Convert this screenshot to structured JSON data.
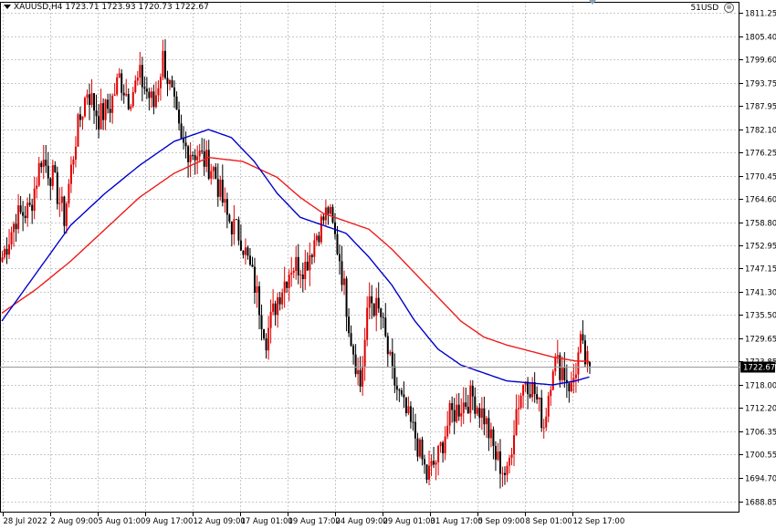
{
  "header": {
    "symbol_line": "XAUUSD,H4  1723.71 1723.93 1720.73 1722.67",
    "indicator_label": "51USD",
    "close_glyph": "⊗"
  },
  "colors": {
    "bull": "#e00000",
    "bear": "#000000",
    "ma_fast": "#0000cc",
    "ma_slow": "#ee1c1c",
    "grid": "#c8c8c8",
    "price_tag_bg": "#000000",
    "price_tag_text": "#ffffff"
  },
  "chart_data": {
    "type": "candlestick",
    "symbol": "XAUUSD",
    "timeframe": "H4",
    "ohlc_current": {
      "open": 1723.71,
      "high": 1723.93,
      "low": 1720.73,
      "close": 1722.67
    },
    "current_price_label": "1722.67",
    "ylim": [
      1686.0,
      1814.0
    ],
    "y_ticks": [
      "1811.25",
      "1805.40",
      "1799.60",
      "1793.75",
      "1787.95",
      "1782.10",
      "1776.25",
      "1770.45",
      "1764.60",
      "1758.80",
      "1752.95",
      "1747.15",
      "1741.30",
      "1735.50",
      "1729.65",
      "1723.85",
      "1718.00",
      "1712.20",
      "1706.35",
      "1700.55",
      "1694.70",
      "1688.85"
    ],
    "x_labels": [
      "28 Jul 2022",
      "2 Aug 09:00",
      "5 Aug 01:00",
      "9 Aug 17:00",
      "12 Aug 09:00",
      "17 Aug 01:00",
      "19 Aug 17:00",
      "24 Aug 09:00",
      "29 Aug 01:00",
      "31 Aug 17:00",
      "5 Sep 09:00",
      "8 Sep 01:00",
      "12 Sep 17:00"
    ],
    "waypoints": [
      [
        0,
        1750
      ],
      [
        6,
        1760
      ],
      [
        12,
        1762
      ],
      [
        17,
        1775
      ],
      [
        22,
        1770
      ],
      [
        27,
        1760
      ],
      [
        32,
        1780
      ],
      [
        37,
        1792
      ],
      [
        42,
        1785
      ],
      [
        47,
        1788
      ],
      [
        51,
        1795
      ],
      [
        55,
        1790
      ],
      [
        60,
        1795
      ],
      [
        66,
        1788
      ],
      [
        70,
        1800
      ],
      [
        74,
        1790
      ],
      [
        78,
        1778
      ],
      [
        85,
        1776
      ],
      [
        92,
        1772
      ],
      [
        98,
        1760
      ],
      [
        104,
        1755
      ],
      [
        110,
        1743
      ],
      [
        115,
        1730
      ],
      [
        120,
        1740
      ],
      [
        126,
        1748
      ],
      [
        132,
        1748
      ],
      [
        137,
        1756
      ],
      [
        142,
        1762
      ],
      [
        147,
        1750
      ],
      [
        152,
        1730
      ],
      [
        156,
        1718
      ],
      [
        160,
        1740
      ],
      [
        165,
        1735
      ],
      [
        170,
        1720
      ],
      [
        175,
        1712
      ],
      [
        180,
        1705
      ],
      [
        185,
        1695
      ],
      [
        190,
        1700
      ],
      [
        195,
        1710
      ],
      [
        200,
        1713
      ],
      [
        205,
        1715
      ],
      [
        210,
        1710
      ],
      [
        215,
        1700
      ],
      [
        220,
        1695
      ],
      [
        224,
        1712
      ],
      [
        228,
        1720
      ],
      [
        232,
        1716
      ],
      [
        236,
        1708
      ],
      [
        240,
        1724
      ],
      [
        244,
        1722
      ],
      [
        248,
        1717
      ],
      [
        252,
        1728
      ],
      [
        254,
        1724
      ],
      [
        256,
        1722.67
      ]
    ],
    "ma_fast": {
      "color": "blue",
      "points": [
        [
          0,
          1734
        ],
        [
          15,
          1746
        ],
        [
          30,
          1758
        ],
        [
          45,
          1766
        ],
        [
          60,
          1773
        ],
        [
          75,
          1779
        ],
        [
          90,
          1782
        ],
        [
          100,
          1780
        ],
        [
          110,
          1774
        ],
        [
          120,
          1766
        ],
        [
          130,
          1760
        ],
        [
          140,
          1758
        ],
        [
          150,
          1756
        ],
        [
          160,
          1750
        ],
        [
          170,
          1743
        ],
        [
          180,
          1734
        ],
        [
          190,
          1727
        ],
        [
          200,
          1723
        ],
        [
          210,
          1721
        ],
        [
          220,
          1719
        ],
        [
          230,
          1718.5
        ],
        [
          240,
          1718
        ],
        [
          250,
          1719
        ],
        [
          256,
          1720
        ]
      ]
    },
    "ma_slow": {
      "color": "red",
      "points": [
        [
          0,
          1736
        ],
        [
          15,
          1742
        ],
        [
          30,
          1749
        ],
        [
          45,
          1757
        ],
        [
          60,
          1765
        ],
        [
          75,
          1771
        ],
        [
          90,
          1775
        ],
        [
          105,
          1774
        ],
        [
          120,
          1770
        ],
        [
          130,
          1765
        ],
        [
          140,
          1761
        ],
        [
          150,
          1759
        ],
        [
          160,
          1757
        ],
        [
          170,
          1752
        ],
        [
          180,
          1746
        ],
        [
          190,
          1740
        ],
        [
          200,
          1734
        ],
        [
          210,
          1730
        ],
        [
          220,
          1728
        ],
        [
          230,
          1726.5
        ],
        [
          240,
          1725
        ],
        [
          250,
          1724
        ],
        [
          256,
          1723.9
        ]
      ]
    }
  }
}
